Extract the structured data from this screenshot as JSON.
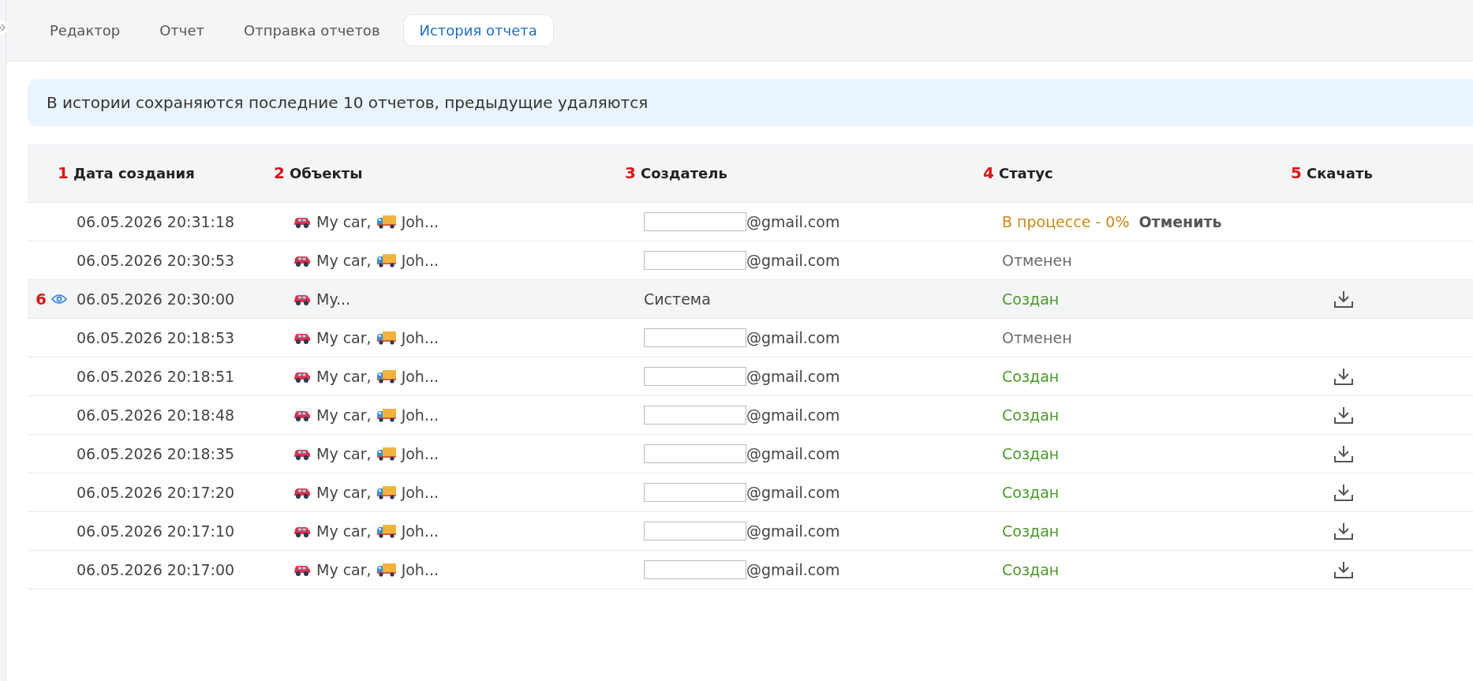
{
  "tabs": [
    {
      "label": "Редактор",
      "selected": false
    },
    {
      "label": "Отчет",
      "selected": false
    },
    {
      "label": "Отправка отчетов",
      "selected": false
    },
    {
      "label": "История отчета",
      "selected": true
    }
  ],
  "notice": "В истории сохраняются последние 10 отчетов, предыдущие удаляются",
  "table": {
    "columns": [
      {
        "marker": "1",
        "label": "Дата создания"
      },
      {
        "marker": "2",
        "label": "Объекты"
      },
      {
        "marker": "3",
        "label": "Создатель"
      },
      {
        "marker": "4",
        "label": "Статус"
      },
      {
        "marker": "5",
        "label": "Скачать"
      }
    ],
    "rows": [
      {
        "date": "06.05.2026 20:31:18",
        "objects": [
          {
            "kind": "car",
            "text": "My car,"
          },
          {
            "kind": "truck",
            "text": "Joh..."
          }
        ],
        "creator": {
          "kind": "email",
          "text": "@gmail.com"
        },
        "status": {
          "kind": "progress",
          "text": "В процессе - 0%",
          "action": "Отменить"
        },
        "download": false,
        "highlighted": false
      },
      {
        "date": "06.05.2026 20:30:53",
        "objects": [
          {
            "kind": "car",
            "text": "My car,"
          },
          {
            "kind": "truck",
            "text": "Joh..."
          }
        ],
        "creator": {
          "kind": "email",
          "text": "@gmail.com"
        },
        "status": {
          "kind": "cancelled",
          "text": "Отменен"
        },
        "download": false,
        "highlighted": false
      },
      {
        "marker": "6",
        "date": "06.05.2026 20:30:00",
        "objects": [
          {
            "kind": "car",
            "text": "My..."
          }
        ],
        "creator": {
          "kind": "system",
          "text": "Система"
        },
        "status": {
          "kind": "created",
          "text": "Создан"
        },
        "download": true,
        "highlighted": true
      },
      {
        "date": "06.05.2026 20:18:53",
        "objects": [
          {
            "kind": "car",
            "text": "My car,"
          },
          {
            "kind": "truck",
            "text": "Joh..."
          }
        ],
        "creator": {
          "kind": "email",
          "text": "@gmail.com"
        },
        "status": {
          "kind": "cancelled",
          "text": "Отменен"
        },
        "download": false,
        "highlighted": false
      },
      {
        "date": "06.05.2026 20:18:51",
        "objects": [
          {
            "kind": "car",
            "text": "My car,"
          },
          {
            "kind": "truck",
            "text": "Joh..."
          }
        ],
        "creator": {
          "kind": "email",
          "text": "@gmail.com"
        },
        "status": {
          "kind": "created",
          "text": "Создан"
        },
        "download": true,
        "highlighted": false
      },
      {
        "date": "06.05.2026 20:18:48",
        "objects": [
          {
            "kind": "car",
            "text": "My car,"
          },
          {
            "kind": "truck",
            "text": "Joh..."
          }
        ],
        "creator": {
          "kind": "email",
          "text": "@gmail.com"
        },
        "status": {
          "kind": "created",
          "text": "Создан"
        },
        "download": true,
        "highlighted": false
      },
      {
        "date": "06.05.2026 20:18:35",
        "objects": [
          {
            "kind": "car",
            "text": "My car,"
          },
          {
            "kind": "truck",
            "text": "Joh..."
          }
        ],
        "creator": {
          "kind": "email",
          "text": "@gmail.com"
        },
        "status": {
          "kind": "created",
          "text": "Создан"
        },
        "download": true,
        "highlighted": false
      },
      {
        "date": "06.05.2026 20:17:20",
        "objects": [
          {
            "kind": "car",
            "text": "My car,"
          },
          {
            "kind": "truck",
            "text": "Joh..."
          }
        ],
        "creator": {
          "kind": "email",
          "text": "@gmail.com"
        },
        "status": {
          "kind": "created",
          "text": "Создан"
        },
        "download": true,
        "highlighted": false
      },
      {
        "date": "06.05.2026 20:17:10",
        "objects": [
          {
            "kind": "car",
            "text": "My car,"
          },
          {
            "kind": "truck",
            "text": "Joh..."
          }
        ],
        "creator": {
          "kind": "email",
          "text": "@gmail.com"
        },
        "status": {
          "kind": "created",
          "text": "Создан"
        },
        "download": true,
        "highlighted": false
      },
      {
        "date": "06.05.2026 20:17:00",
        "objects": [
          {
            "kind": "car",
            "text": "My car,"
          },
          {
            "kind": "truck",
            "text": "Joh..."
          }
        ],
        "creator": {
          "kind": "email",
          "text": "@gmail.com"
        },
        "status": {
          "kind": "created",
          "text": "Создан"
        },
        "download": true,
        "highlighted": false
      }
    ]
  }
}
